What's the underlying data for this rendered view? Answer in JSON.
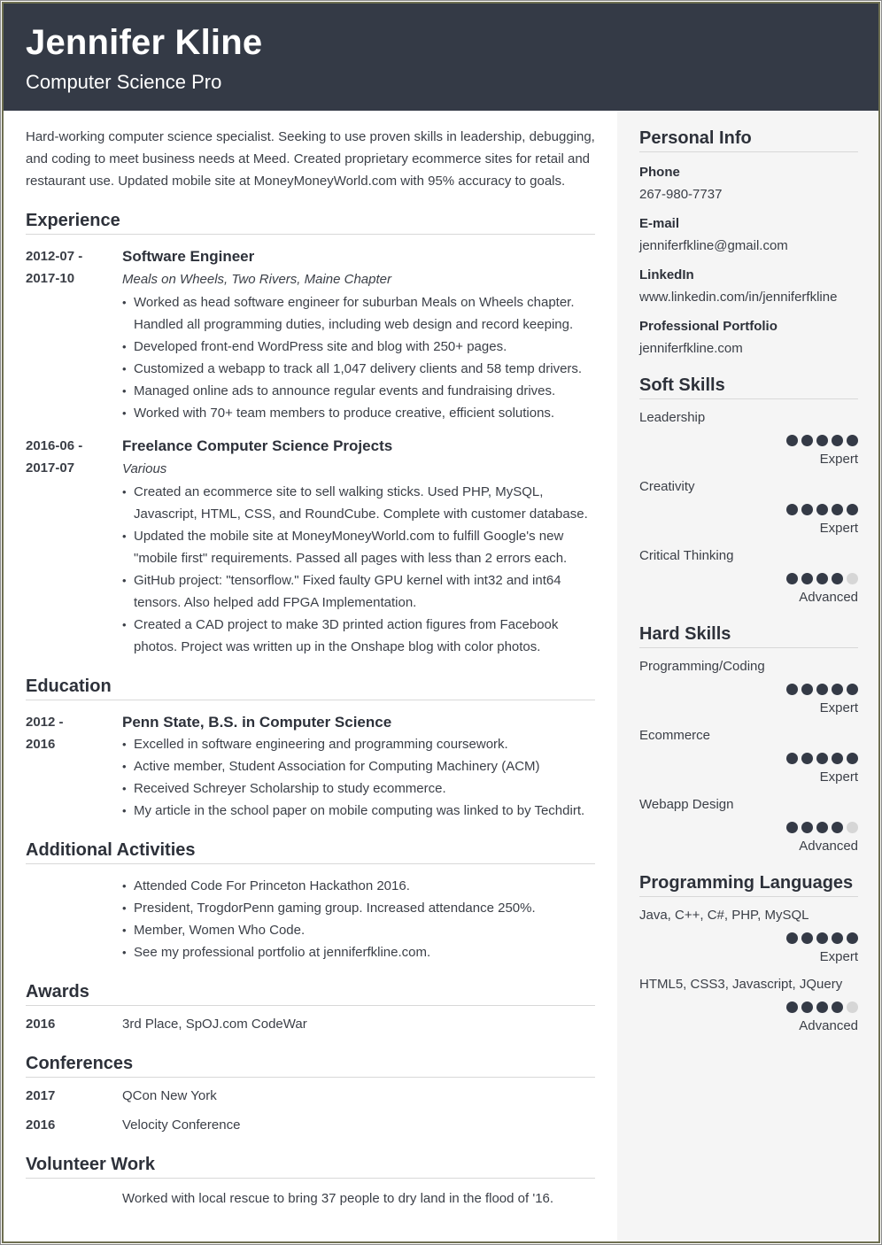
{
  "colors": {
    "header_bg": "#343a46",
    "sidebar_bg": "#f5f5f5",
    "dot_on": "#343a46",
    "dot_off": "#d6d6d6"
  },
  "header": {
    "name": "Jennifer Kline",
    "title": "Computer Science Pro"
  },
  "summary": "Hard-working computer science specialist. Seeking to use proven skills in leadership, debugging, and coding to meet business needs at Meed. Created proprietary ecommerce sites for retail and restaurant use. Updated mobile site at MoneyMoneyWorld.com with 95% accuracy to goals.",
  "experience": {
    "heading": "Experience",
    "jobs": [
      {
        "date_start": "2012-07 -",
        "date_end": "2017-10",
        "role": "Software Engineer",
        "org": "Meals on Wheels, Two Rivers, Maine Chapter",
        "bullets": [
          "Worked as head software engineer for suburban Meals on Wheels chapter. Handled all programming duties, including web design and record keeping.",
          "Developed front-end WordPress site and blog with 250+ pages.",
          "Customized a webapp to track all 1,047 delivery clients and 58 temp drivers.",
          "Managed online ads to announce regular events and fundraising drives.",
          "Worked with 70+ team members to produce creative, efficient solutions."
        ]
      },
      {
        "date_start": "2016-06 -",
        "date_end": "2017-07",
        "role": "Freelance Computer Science Projects",
        "org": "Various",
        "bullets": [
          "Created an ecommerce site to sell walking sticks. Used PHP, MySQL, Javascript, HTML, CSS, and RoundCube. Complete with customer database.",
          "Updated the mobile site at MoneyMoneyWorld.com to fulfill Google's new \"mobile first\" requirements. Passed all pages with less than 2 errors each.",
          "GitHub project: \"tensorflow.\" Fixed faulty GPU kernel with int32 and int64 tensors. Also helped add FPGA Implementation.",
          "Created a CAD project to make 3D printed action figures from Facebook photos. Project was written up in the Onshape blog with color photos."
        ]
      }
    ]
  },
  "education": {
    "heading": "Education",
    "date_start": "2012 -",
    "date_end": "2016",
    "degree": "Penn State, B.S. in Computer Science",
    "bullets": [
      "Excelled in software engineering and programming coursework.",
      "Active member, Student Association for Computing Machinery (ACM)",
      "Received Schreyer Scholarship to study ecommerce.",
      "My article in the school paper on mobile computing was linked to by Techdirt."
    ]
  },
  "activities": {
    "heading": "Additional Activities",
    "bullets": [
      "Attended Code For Princeton Hackathon 2016.",
      "President, TrogdorPenn gaming group. Increased attendance 250%.",
      "Member, Women Who Code.",
      "See my professional portfolio at jenniferfkline.com."
    ]
  },
  "awards": {
    "heading": "Awards",
    "items": [
      {
        "year": "2016",
        "text": "3rd Place, SpOJ.com CodeWar"
      }
    ]
  },
  "conferences": {
    "heading": "Conferences",
    "items": [
      {
        "year": "2017",
        "text": "QCon New York"
      },
      {
        "year": "2016",
        "text": "Velocity Conference"
      }
    ]
  },
  "volunteer": {
    "heading": "Volunteer Work",
    "text": "Worked with local rescue to bring 37 people to dry land in the flood of '16."
  },
  "personal_info": {
    "heading": "Personal Info",
    "fields": [
      {
        "label": "Phone",
        "value": "267-980-7737"
      },
      {
        "label": "E-mail",
        "value": "jenniferfkline@gmail.com"
      },
      {
        "label": "LinkedIn",
        "value": "www.linkedin.com/in/jenniferfkline"
      },
      {
        "label": "Professional Portfolio",
        "value": "jenniferfkline.com"
      }
    ]
  },
  "soft_skills": {
    "heading": "Soft Skills",
    "items": [
      {
        "name": "Leadership",
        "rating": 5,
        "max": 5,
        "level": "Expert"
      },
      {
        "name": "Creativity",
        "rating": 5,
        "max": 5,
        "level": "Expert"
      },
      {
        "name": "Critical Thinking",
        "rating": 4,
        "max": 5,
        "level": "Advanced"
      }
    ]
  },
  "hard_skills": {
    "heading": "Hard Skills",
    "items": [
      {
        "name": "Programming/Coding",
        "rating": 5,
        "max": 5,
        "level": "Expert"
      },
      {
        "name": "Ecommerce",
        "rating": 5,
        "max": 5,
        "level": "Expert"
      },
      {
        "name": "Webapp Design",
        "rating": 4,
        "max": 5,
        "level": "Advanced"
      }
    ]
  },
  "languages": {
    "heading": "Programming Languages",
    "items": [
      {
        "name": "Java, C++, C#, PHP, MySQL",
        "rating": 5,
        "max": 5,
        "level": "Expert"
      },
      {
        "name": "HTML5, CSS3, Javascript, JQuery",
        "rating": 4,
        "max": 5,
        "level": "Advanced"
      }
    ]
  }
}
